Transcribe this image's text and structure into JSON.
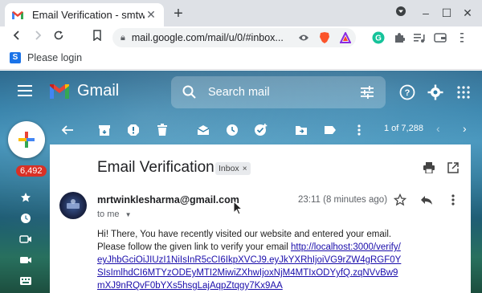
{
  "browser": {
    "tab_title": "Email Verification - smtwinkle",
    "url": "mail.google.com/mail/u/0/#inbox...",
    "bookmark_label": "Please login",
    "bookmark_icon_letter": "S"
  },
  "gmail": {
    "brand": "Gmail",
    "search_placeholder": "Search mail",
    "unread_count": "6,492",
    "pager": "1 of 7,288",
    "accent_red": "#d93025"
  },
  "email": {
    "subject": "Email Verification",
    "label": "Inbox",
    "label_close": "×",
    "sender": "mrtwinklesharma@gmail.com",
    "to": "to me",
    "time": "23:11 (8 minutes ago)",
    "body_line1": "Hi! There, You have recently visited our website and entered your email.",
    "body_line2": "Please follow the given link to verify your email ",
    "link": "http://localhost:3000/verify/eyJhbGciOiJIUzI1NiIsInR5cCI6IkpXVCJ9.eyJkYXRhIjoiVG9rZW4gRGF0YSIsImlhdCI6MTYzODEyMTI2MiwiZXhwIjoxNjM4MTIxODYyfQ.zqNVvBw9mXJ9nRQvF0bYXs5hsgLajAqpZtqgy7Kx9AA"
  }
}
